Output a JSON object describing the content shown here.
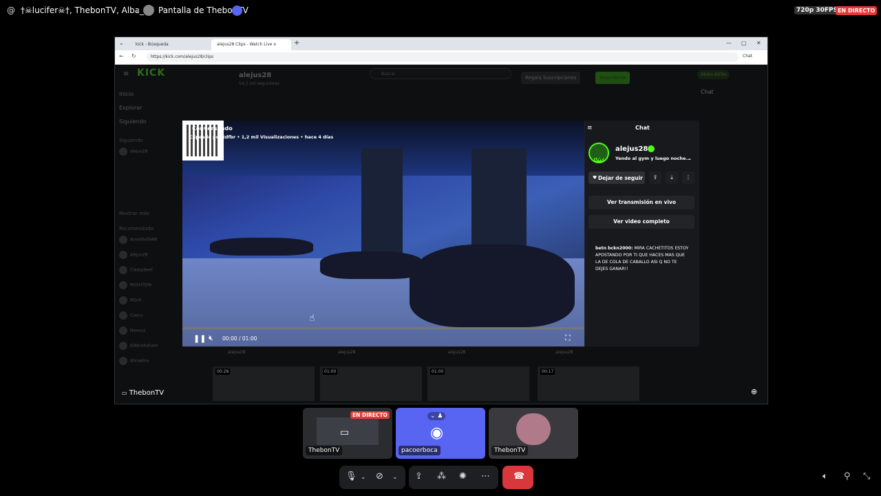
{
  "top_bar": {
    "at_symbol": "@",
    "participants": "†☠lucifer☠†, ThebonTV, Alba_06",
    "screen_title": "Pantalla de ThebonTV",
    "quality": "720p 30FPS",
    "live_badge": "EN DIRECTO"
  },
  "browser": {
    "tabs": [
      "kick - Búsqueda",
      "alejus28 Clips - Watch Live o"
    ],
    "new_tab": "+",
    "url": "https://kick.com/alejus28/clips",
    "chat_button": "Chat"
  },
  "kick_page": {
    "logo": "KICK",
    "search_placeholder": "Buscar",
    "get_kicks": "Obtén KICKs",
    "sidebar": {
      "nav": [
        "Inicio",
        "Explorar",
        "Siguiendo"
      ],
      "following_header": "Siguiendo",
      "recommended_header": "Recomendado",
      "show_more": "Mostrar más",
      "channels": [
        "alejus28",
        "Arnoldville96",
        "alejus28",
        "Classybeef",
        "ROSHTEIN",
        "M2o5",
        "Coscu",
        "Nexxuz",
        "ElAbrahaham",
        "Ahriadna"
      ]
    },
    "channel_name": "alejus28",
    "followers": "54,3 mil seguidores",
    "gift_subs": "Regala Suscripciones",
    "subscribe": "Suscribirse",
    "chat_title": "Chat",
    "thumb_times": [
      "00:28",
      "01:00",
      "01:00",
      "00:17"
    ],
    "thumb_channel": "alejus28"
  },
  "clip_modal": {
    "title": "Conversando",
    "meta": "Clipeado por tdfbr • 1,2 mil Visualizaciones • hace 4 días",
    "time": "00:00 / 01:00",
    "chat_header": "Chat",
    "channel": "alejus28",
    "live_tag": "LIVE",
    "status": "Yendo al gym y luego noche...",
    "unfollow": "Dejar de seguir",
    "watch_live": "Ver transmisión en vivo",
    "watch_full": "Ver video completo",
    "message_user": "betn bckn2000:",
    "message_text": "MIRA CACHETITOS ESTOY APOSTANDO POR TI QUE HACES MAS QUE LA DE COLA DE CABALLO ASI Q NO TE DEJES GANAR!!"
  },
  "stream_owner": "ThebonTV",
  "tiles": [
    {
      "label": "ThebonTV",
      "live": "EN DIRECTO"
    },
    {
      "label": "pacoerboca"
    },
    {
      "label": "ThebonTV"
    }
  ],
  "colors": {
    "kick_green": "#53fc18",
    "live_red": "#e53935",
    "discord_blurple": "#5865f2",
    "hangup_red": "#da373c"
  }
}
